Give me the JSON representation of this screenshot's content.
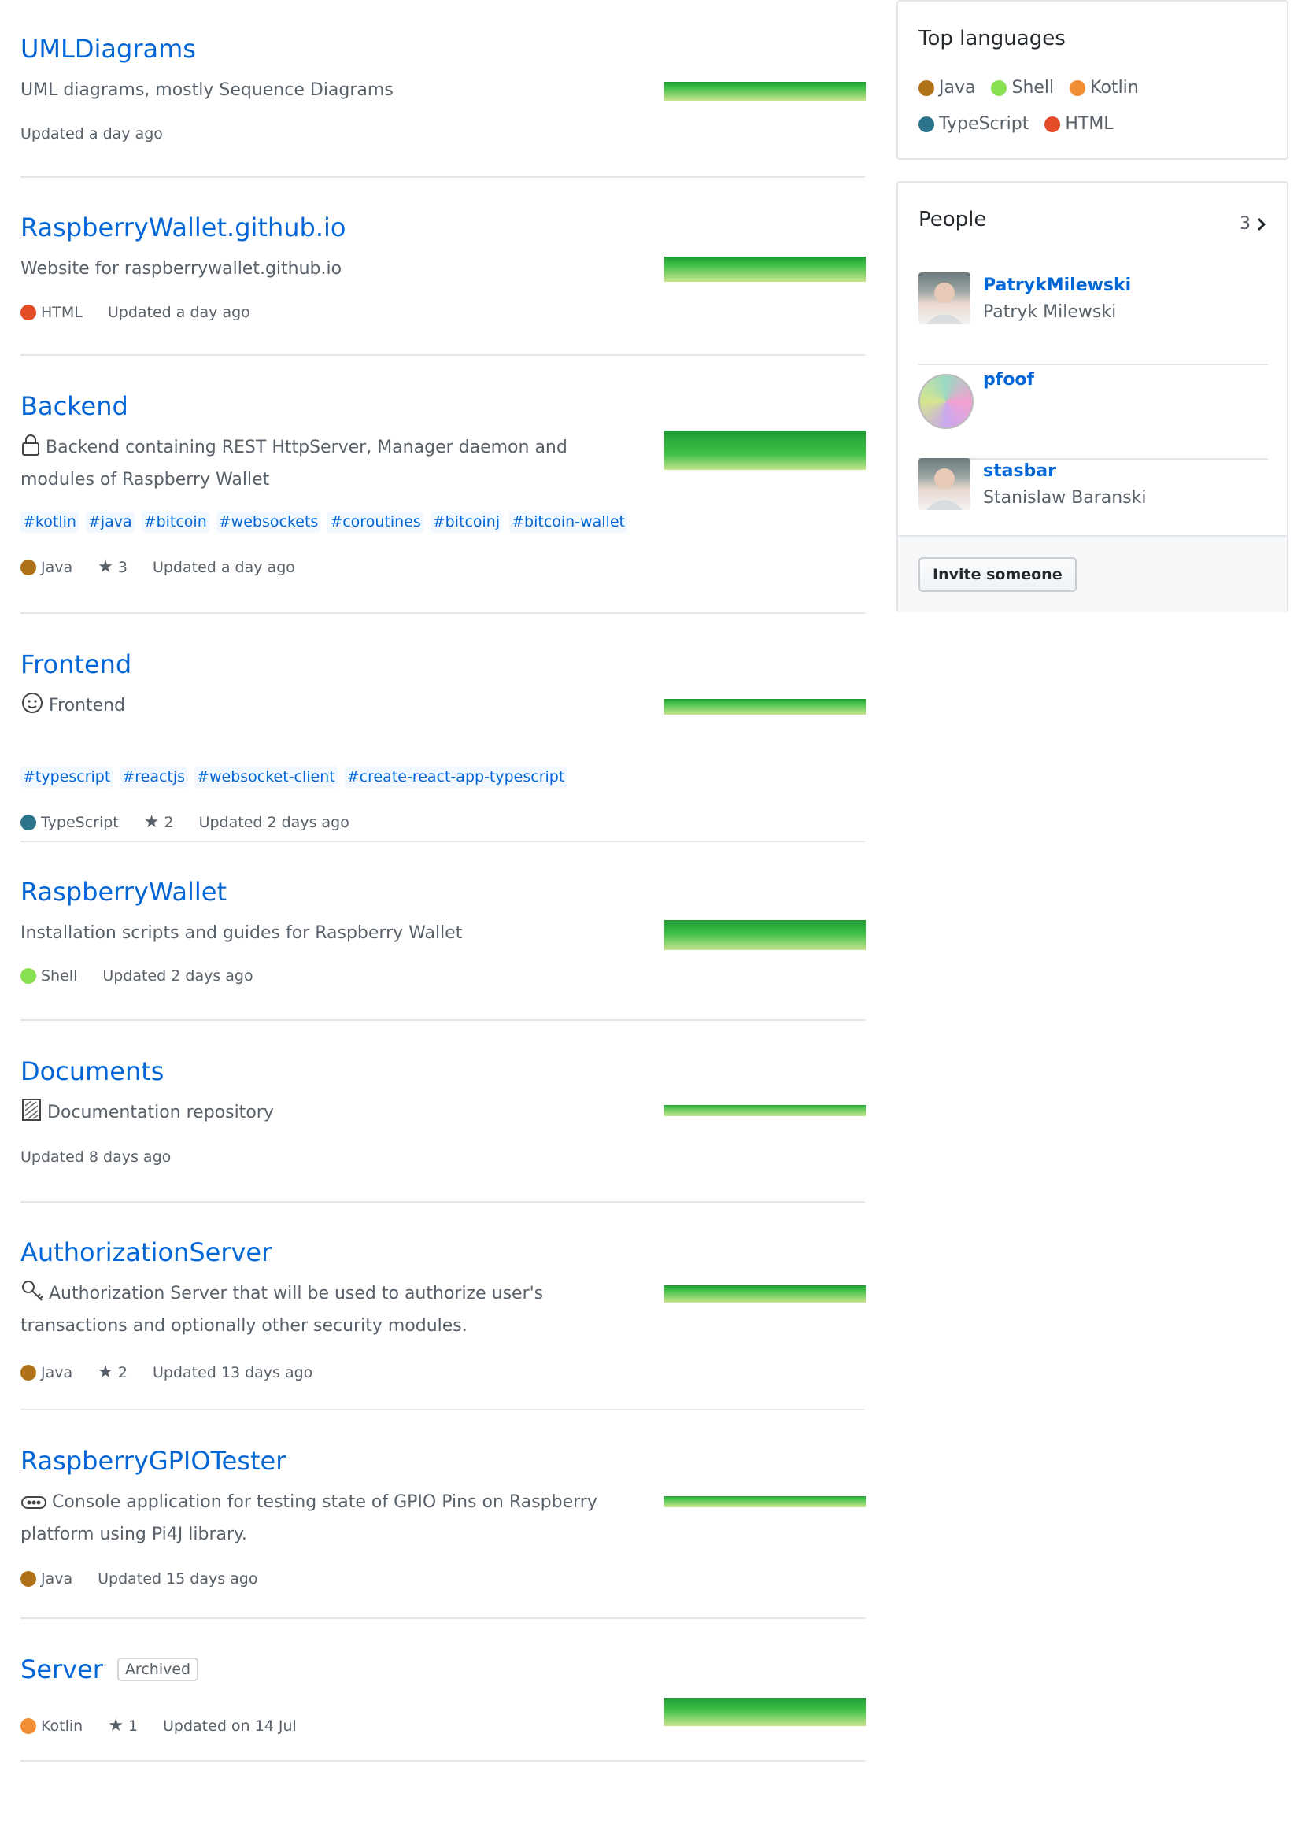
{
  "colors": {
    "Java": "#b07219",
    "Shell": "#89e051",
    "Kotlin": "#F18E33",
    "TypeScript": "#2b7489",
    "HTML": "#e34c26",
    "link": "#0366d6"
  },
  "repos": [
    {
      "name": "UMLDiagrams",
      "description": "UML diagrams, mostly Sequence Diagrams",
      "desc_icon": "",
      "topics": [],
      "language": "",
      "stars": "",
      "updated": "Updated a day ago",
      "archived": "",
      "activity": 0.5
    },
    {
      "name": "RaspberryWallet.github.io",
      "description": "Website for raspberrywallet.github.io",
      "desc_icon": "",
      "topics": [],
      "language": "HTML",
      "stars": "",
      "updated": "Updated a day ago",
      "archived": "",
      "activity": 0.55
    },
    {
      "name": "Backend",
      "description": "Backend containing REST HttpServer, Manager daemon and modules of Raspberry Wallet",
      "desc_icon": "lock-icon",
      "topics": [
        "#kotlin",
        "#java",
        "#bitcoin",
        "#websockets",
        "#coroutines",
        "#bitcoinj",
        "#bitcoin-wallet"
      ],
      "language": "Java",
      "stars": "3",
      "updated": "Updated a day ago",
      "archived": "",
      "activity": 1.0
    },
    {
      "name": "Frontend",
      "description": "Frontend",
      "desc_icon": "face-icon",
      "topics": [
        "#typescript",
        "#reactjs",
        "#websocket-client",
        "#create-react-app-typescript"
      ],
      "language": "TypeScript",
      "stars": "2",
      "updated": "Updated 2 days ago",
      "archived": "",
      "activity": 0.4
    },
    {
      "name": "RaspberryWallet",
      "description": "Installation scripts and guides for Raspberry Wallet",
      "desc_icon": "",
      "topics": [],
      "language": "Shell",
      "stars": "",
      "updated": "Updated 2 days ago",
      "archived": "",
      "activity": 0.75
    },
    {
      "name": "Documents",
      "description": "Documentation repository",
      "desc_icon": "document-icon",
      "topics": [],
      "language": "",
      "stars": "",
      "updated": "Updated 8 days ago",
      "archived": "",
      "activity": 0.2
    },
    {
      "name": "AuthorizationServer",
      "description": "Authorization Server that will be used to authorize user's transactions and optionally other security modules.",
      "desc_icon": "key-icon",
      "topics": [],
      "language": "Java",
      "stars": "2",
      "updated": "Updated 13 days ago",
      "archived": "",
      "activity": 0.45
    },
    {
      "name": "RaspberryGPIOTester",
      "description": "Console application for testing state of GPIO Pins on Raspberry platform using Pi4J library.",
      "desc_icon": "chip-icon",
      "topics": [],
      "language": "Java",
      "stars": "",
      "updated": "Updated 15 days ago",
      "archived": "",
      "activity": 0.3
    },
    {
      "name": "Server",
      "description": "",
      "desc_icon": "",
      "topics": [],
      "language": "Kotlin",
      "stars": "1",
      "updated": "Updated on 14 Jul",
      "archived": "Archived",
      "activity": 0.7
    }
  ],
  "top_languages": {
    "title": "Top languages",
    "items": [
      "Java",
      "Shell",
      "Kotlin",
      "TypeScript",
      "HTML"
    ]
  },
  "people": {
    "title": "People",
    "count": "3",
    "members": [
      {
        "login": "PatrykMilewski",
        "name": "Patryk Milewski",
        "avatar": "photo-avatar"
      },
      {
        "login": "pfoof",
        "name": "",
        "avatar": "identicon-avatar"
      },
      {
        "login": "stasbar",
        "name": "Stanislaw Baranski",
        "avatar": "photo-avatar"
      }
    ],
    "invite_label": "Invite someone"
  }
}
